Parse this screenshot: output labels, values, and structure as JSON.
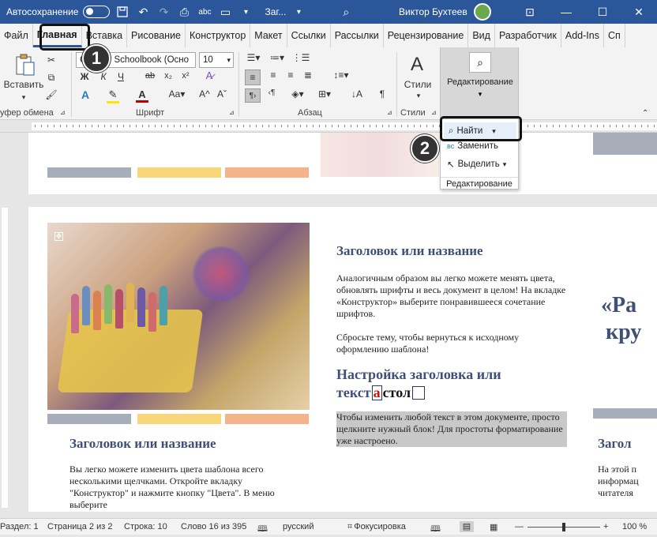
{
  "titlebar": {
    "autosave": "Автосохранение",
    "doc_title": "Заг...",
    "user": "Виктор Бухтеев"
  },
  "tabs": [
    "Файл",
    "Главная",
    "Вставка",
    "Рисование",
    "Конструктор",
    "Макет",
    "Ссылки",
    "Рассылки",
    "Рецензирование",
    "Вид",
    "Разработчик",
    "Add-Ins",
    "Сп"
  ],
  "ribbon": {
    "paste_label": "Вставить",
    "clipboard_group": "уфер обмена",
    "font_name": "Century Schoolbook (Осно",
    "font_size": "10",
    "font_group": "Шрифт",
    "paragraph_group": "Абзац",
    "styles_label": "Стили",
    "styles_group": "Стили",
    "editing_label": "Редактирование"
  },
  "dropdown": {
    "find": "Найти",
    "replace": "Заменить",
    "select": "Выделить",
    "footer": "Редактирование"
  },
  "doc": {
    "col2_heading": "Заголовок или название",
    "col2_para1": "Аналогичным образом вы легко можете менять цвета, обновлять шрифты и весь документ в целом! На вкладке «Конструктор» выберите понравившееся сочетание шрифтов.",
    "col2_para2": "Сбросьте тему, чтобы вернуться к исходному оформлению шаблона!",
    "col2_heading2_line1": "Настройка заголовка или",
    "col2_heading2_pre": "текст",
    "col2_heading2_mark": "а",
    "col2_heading2_post": "стол",
    "col2_selected": "Чтобы изменить любой текст в этом документе, просто щелкните нужный блок! Для простоты форматирование уже настроено.",
    "col1_heading": "Заголовок или название",
    "col1_para": "Вы легко можете изменить цвета шаблона всего несколькими щелчками. Откройте вкладку \"Конструктор\" и нажмите кнопку \"Цвета\". В меню выберите",
    "col3_quote_line1": "«Ра",
    "col3_quote_line2": "кру",
    "col3_heading": "Загол",
    "col3_para": "На этой п информац читателя"
  },
  "status": {
    "section": "Раздел: 1",
    "page": "Страница 2 из 2",
    "line": "Строка: 10",
    "words": "Слово 16 из 395",
    "language": "русский",
    "focus": "Фокусировка",
    "zoom": "100 %"
  },
  "callouts": {
    "one": "1",
    "two": "2"
  },
  "colors": {
    "word_blue": "#2b579a",
    "heading_blue": "#3f4f75",
    "bar_gray": "#a7aeb9",
    "bar_yellow": "#f8d67a",
    "bar_orange": "#f3b48c"
  }
}
